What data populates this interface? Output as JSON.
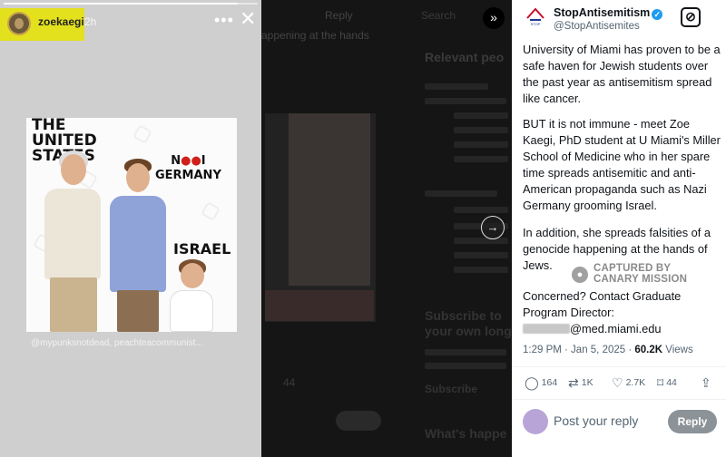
{
  "story": {
    "progress": 0.92,
    "username": "zoekaegi",
    "time": "2h",
    "more_icon": "more-horizontal-icon",
    "close_icon": "close-icon",
    "image": {
      "caption_us": "THE UNITED STATES",
      "caption_germany_prefix": "N",
      "caption_germany_red": "●●",
      "caption_germany_suffix": "I",
      "caption_germany_line2": "GERMANY",
      "caption_israel": "ISRAEL"
    },
    "credit": "@mypunksnotdead, peachteacommunist..."
  },
  "background": {
    "reply_label": "Reply",
    "ghost_text": "appening at the hands",
    "search_label": "Search",
    "relevant_heading": "Relevant peo",
    "subscribe_heading": "Subscribe to\nyour own long",
    "subscribe_button": "Subscribe",
    "happening_heading": "What's happe",
    "stat": "44"
  },
  "nav": {
    "forward_icon": "double-chevron-right-icon",
    "next_icon": "arrow-right-icon"
  },
  "tweet": {
    "author_name": "StopAntisemitism",
    "author_handle": "@StopAntisemites",
    "verified_icon": "verified-badge-icon",
    "grok_icon": "grok-icon",
    "paragraphs": [
      "University of Miami has proven to be a safe haven for Jewish students over the past year as antisemitism spread like cancer.",
      "BUT it is not immune - meet Zoe Kaegi, PhD student at U Miami's Miller School of Medicine who in her spare time spreads antisemitic and anti-American propaganda such as Nazi Germany grooming Israel.",
      "In addition, she spreads falsities of a genocide happening at the hands of Jews.",
      "Concerned? Contact Graduate Program Director:"
    ],
    "email_suffix": "@med.miami.edu",
    "watermark": "CAPTURED BY\nCANARY MISSION",
    "time": "1:29 PM · Jan 5, 2025 · ",
    "views_count": "60.2K",
    "views_label": " Views",
    "actions": {
      "replies": "164",
      "reposts": "1K",
      "likes": "2.7K",
      "bookmarks": "44"
    },
    "reply_placeholder": "Post your reply",
    "reply_button": "Reply"
  }
}
